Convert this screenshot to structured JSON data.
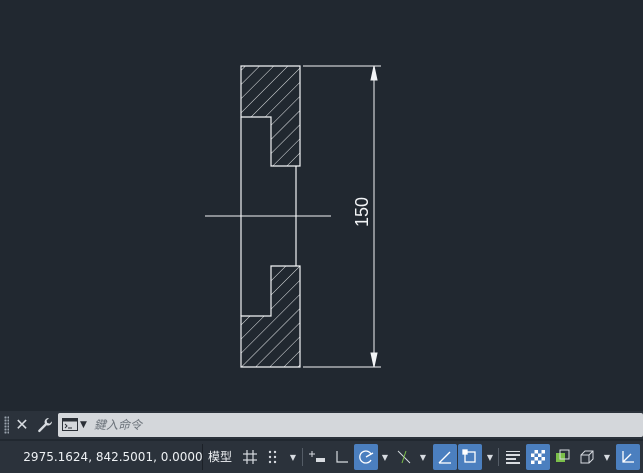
{
  "drawing": {
    "dimension_text": "150"
  },
  "command_line": {
    "placeholder": "鍵入命令",
    "close_icon": "close-icon",
    "customize_icon": "wrench-icon"
  },
  "status_bar": {
    "coordinates": "2975.1624, 842.5001, 0.0000",
    "model_label": "模型"
  },
  "colors": {
    "canvas_bg": "#212830",
    "geometry": "#ffffff",
    "active_button": "#4b7fbf"
  }
}
